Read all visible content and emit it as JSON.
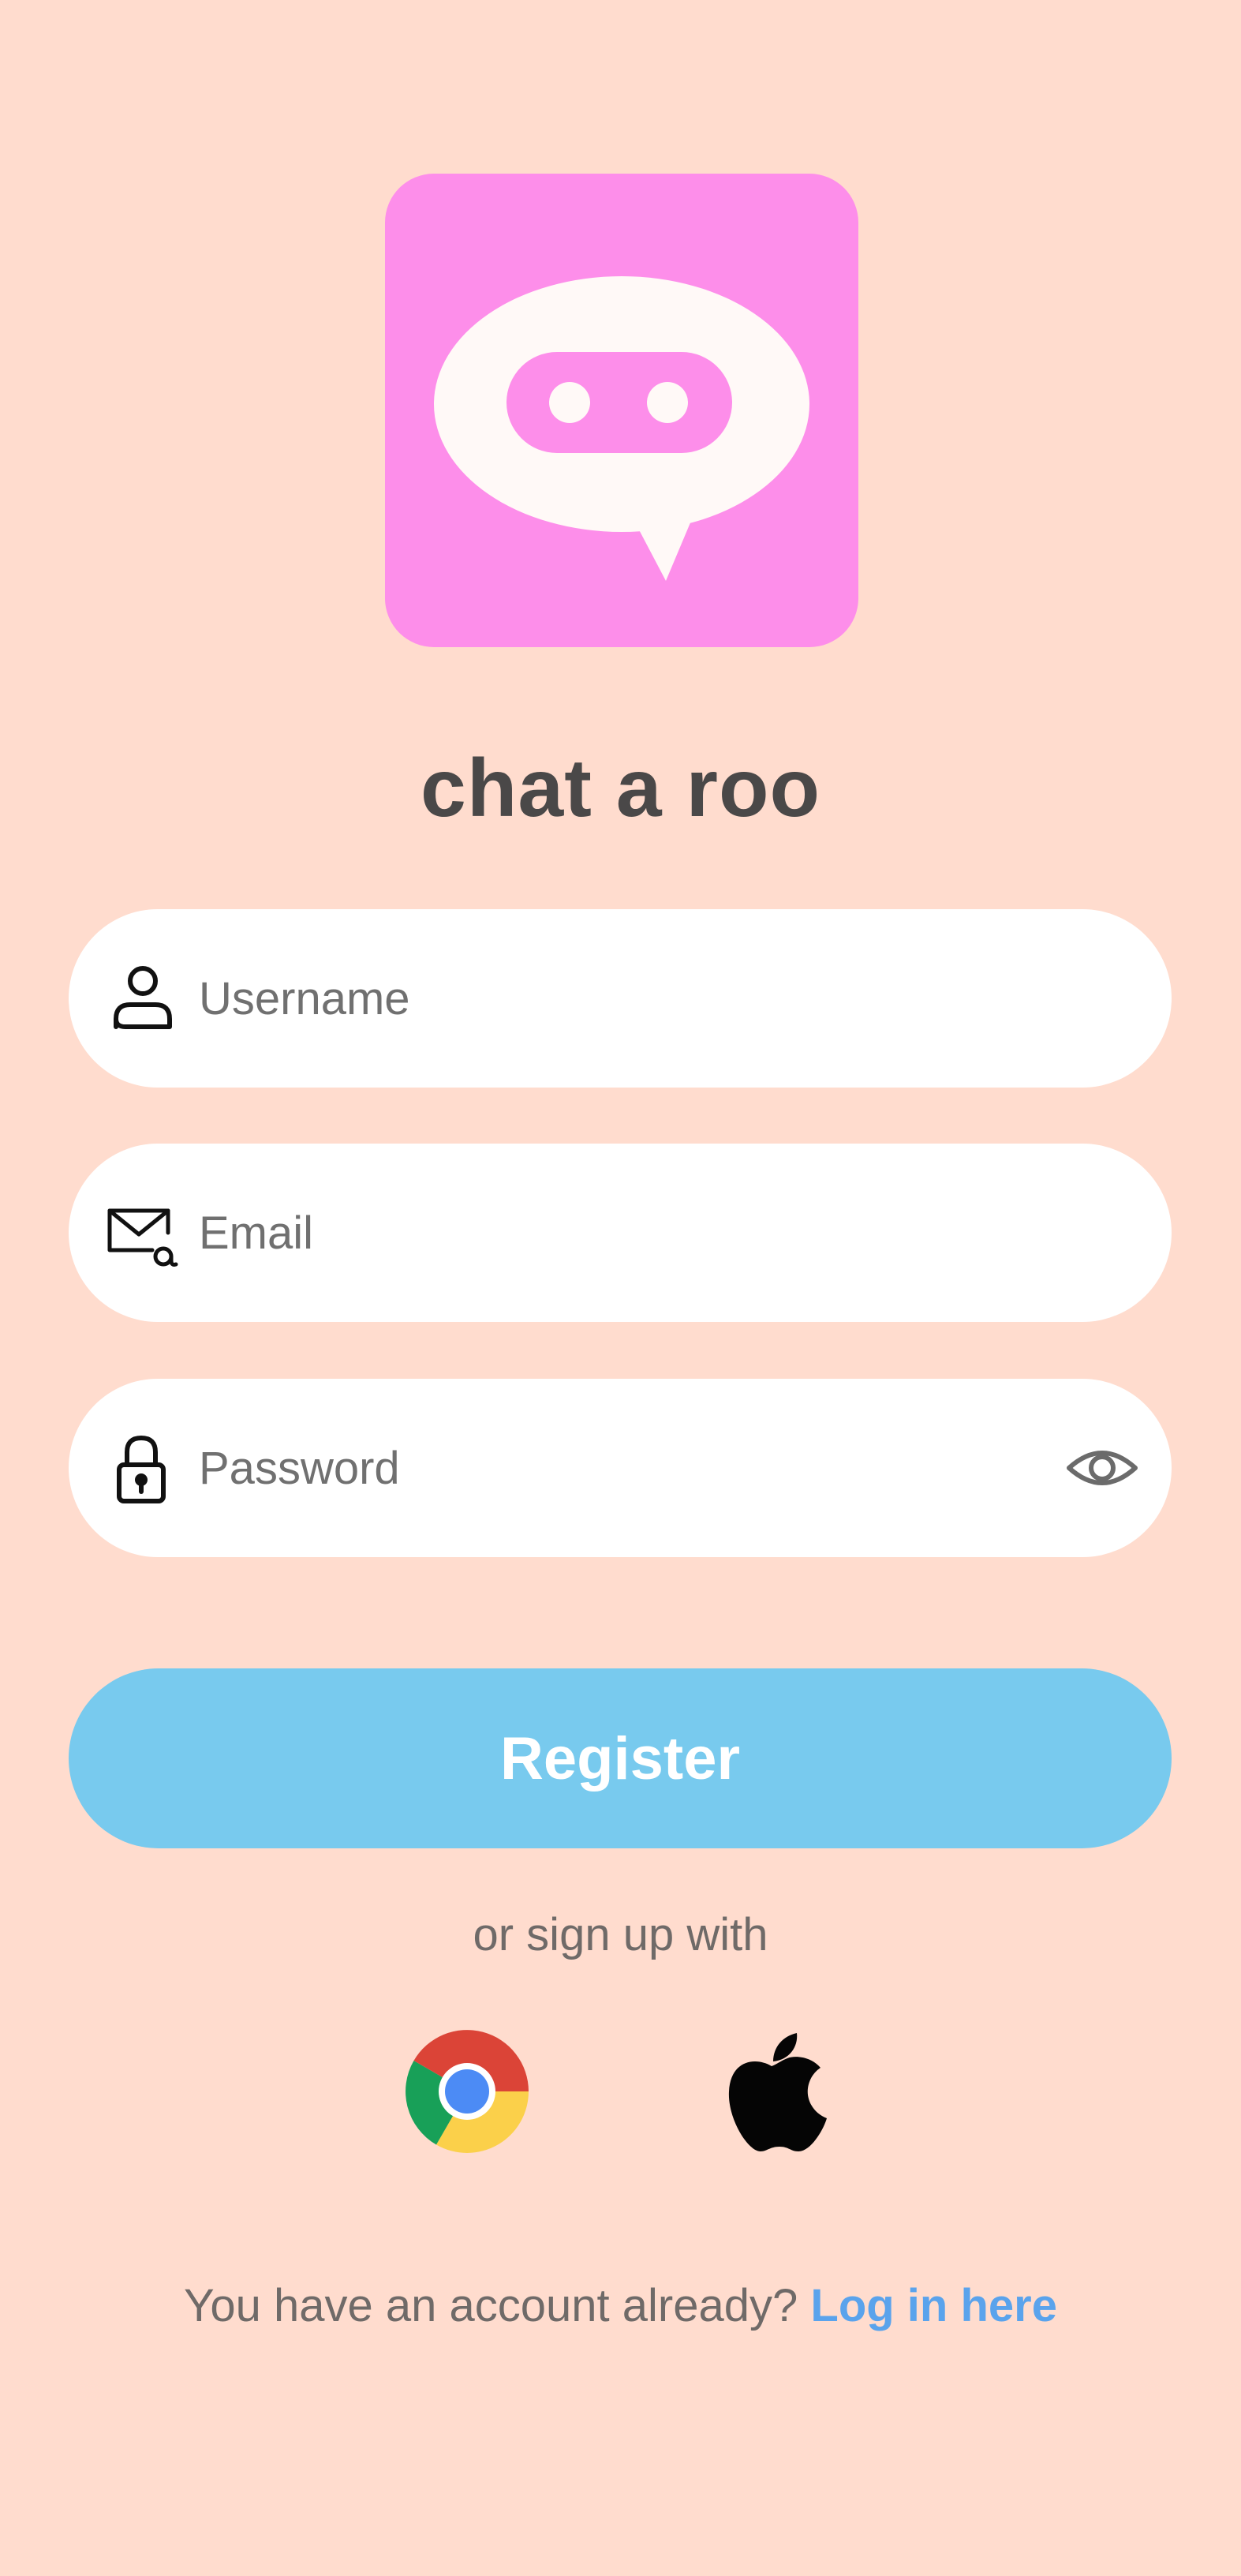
{
  "app": {
    "title": "chat a roo"
  },
  "form": {
    "username": {
      "placeholder": "Username",
      "value": ""
    },
    "email": {
      "placeholder": "Email",
      "value": ""
    },
    "password": {
      "placeholder": "Password",
      "value": ""
    }
  },
  "actions": {
    "register_label": "Register",
    "alt_signup_text": "or sign up with"
  },
  "social": [
    {
      "name": "chrome-icon"
    },
    {
      "name": "apple-icon"
    }
  ],
  "footer": {
    "prompt": "You have an account already?",
    "link_label": "Log in here"
  },
  "icons": {
    "username": "user-icon",
    "email": "mail-at-icon",
    "password": "lock-icon",
    "toggle": "eye-icon"
  },
  "colors": {
    "background": "#FFDCCE",
    "logo": "#FD8EEA",
    "title": "#4A4848",
    "register": "#78CAEE",
    "link": "#5AA3EC"
  }
}
